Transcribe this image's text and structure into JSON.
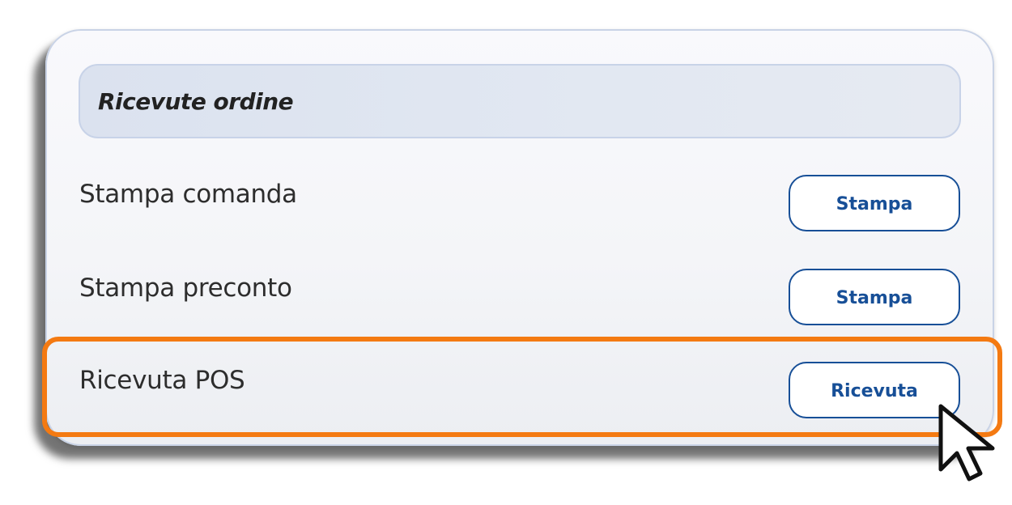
{
  "section": {
    "title": "Ricevute ordine"
  },
  "rows": [
    {
      "label": "Stampa comanda",
      "button_label": "Stampa"
    },
    {
      "label": "Stampa preconto",
      "button_label": "Stampa"
    },
    {
      "label": "Ricevuta POS",
      "button_label": "Ricevuta"
    }
  ],
  "colors": {
    "button_accent": "#174f97",
    "highlight": "#f47a12",
    "header_background": "#dbe2ef"
  },
  "icons": {
    "cursor": "mouse-pointer-icon"
  }
}
